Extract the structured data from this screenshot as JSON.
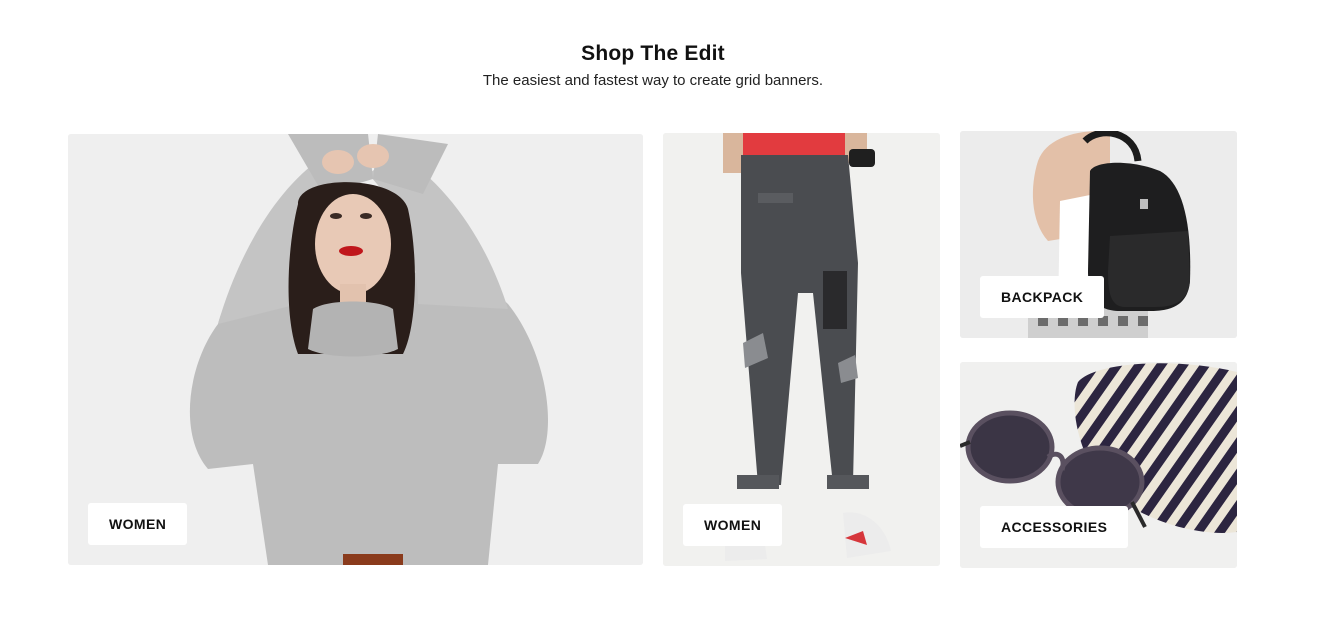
{
  "section": {
    "title": "Shop The Edit",
    "subtitle": "The easiest and fastest way to create grid banners."
  },
  "banners": [
    {
      "label": "WOMEN",
      "image": "woman-grey-sweater-photo"
    },
    {
      "label": "WOMEN",
      "image": "ripped-jeans-photo"
    },
    {
      "label": "BACKPACK",
      "image": "black-backpack-photo"
    },
    {
      "label": "ACCESSORIES",
      "image": "sunglasses-photo"
    }
  ],
  "colors": {
    "banner_bg": "#efefef",
    "label_bg": "#ffffff",
    "text": "#111111"
  }
}
